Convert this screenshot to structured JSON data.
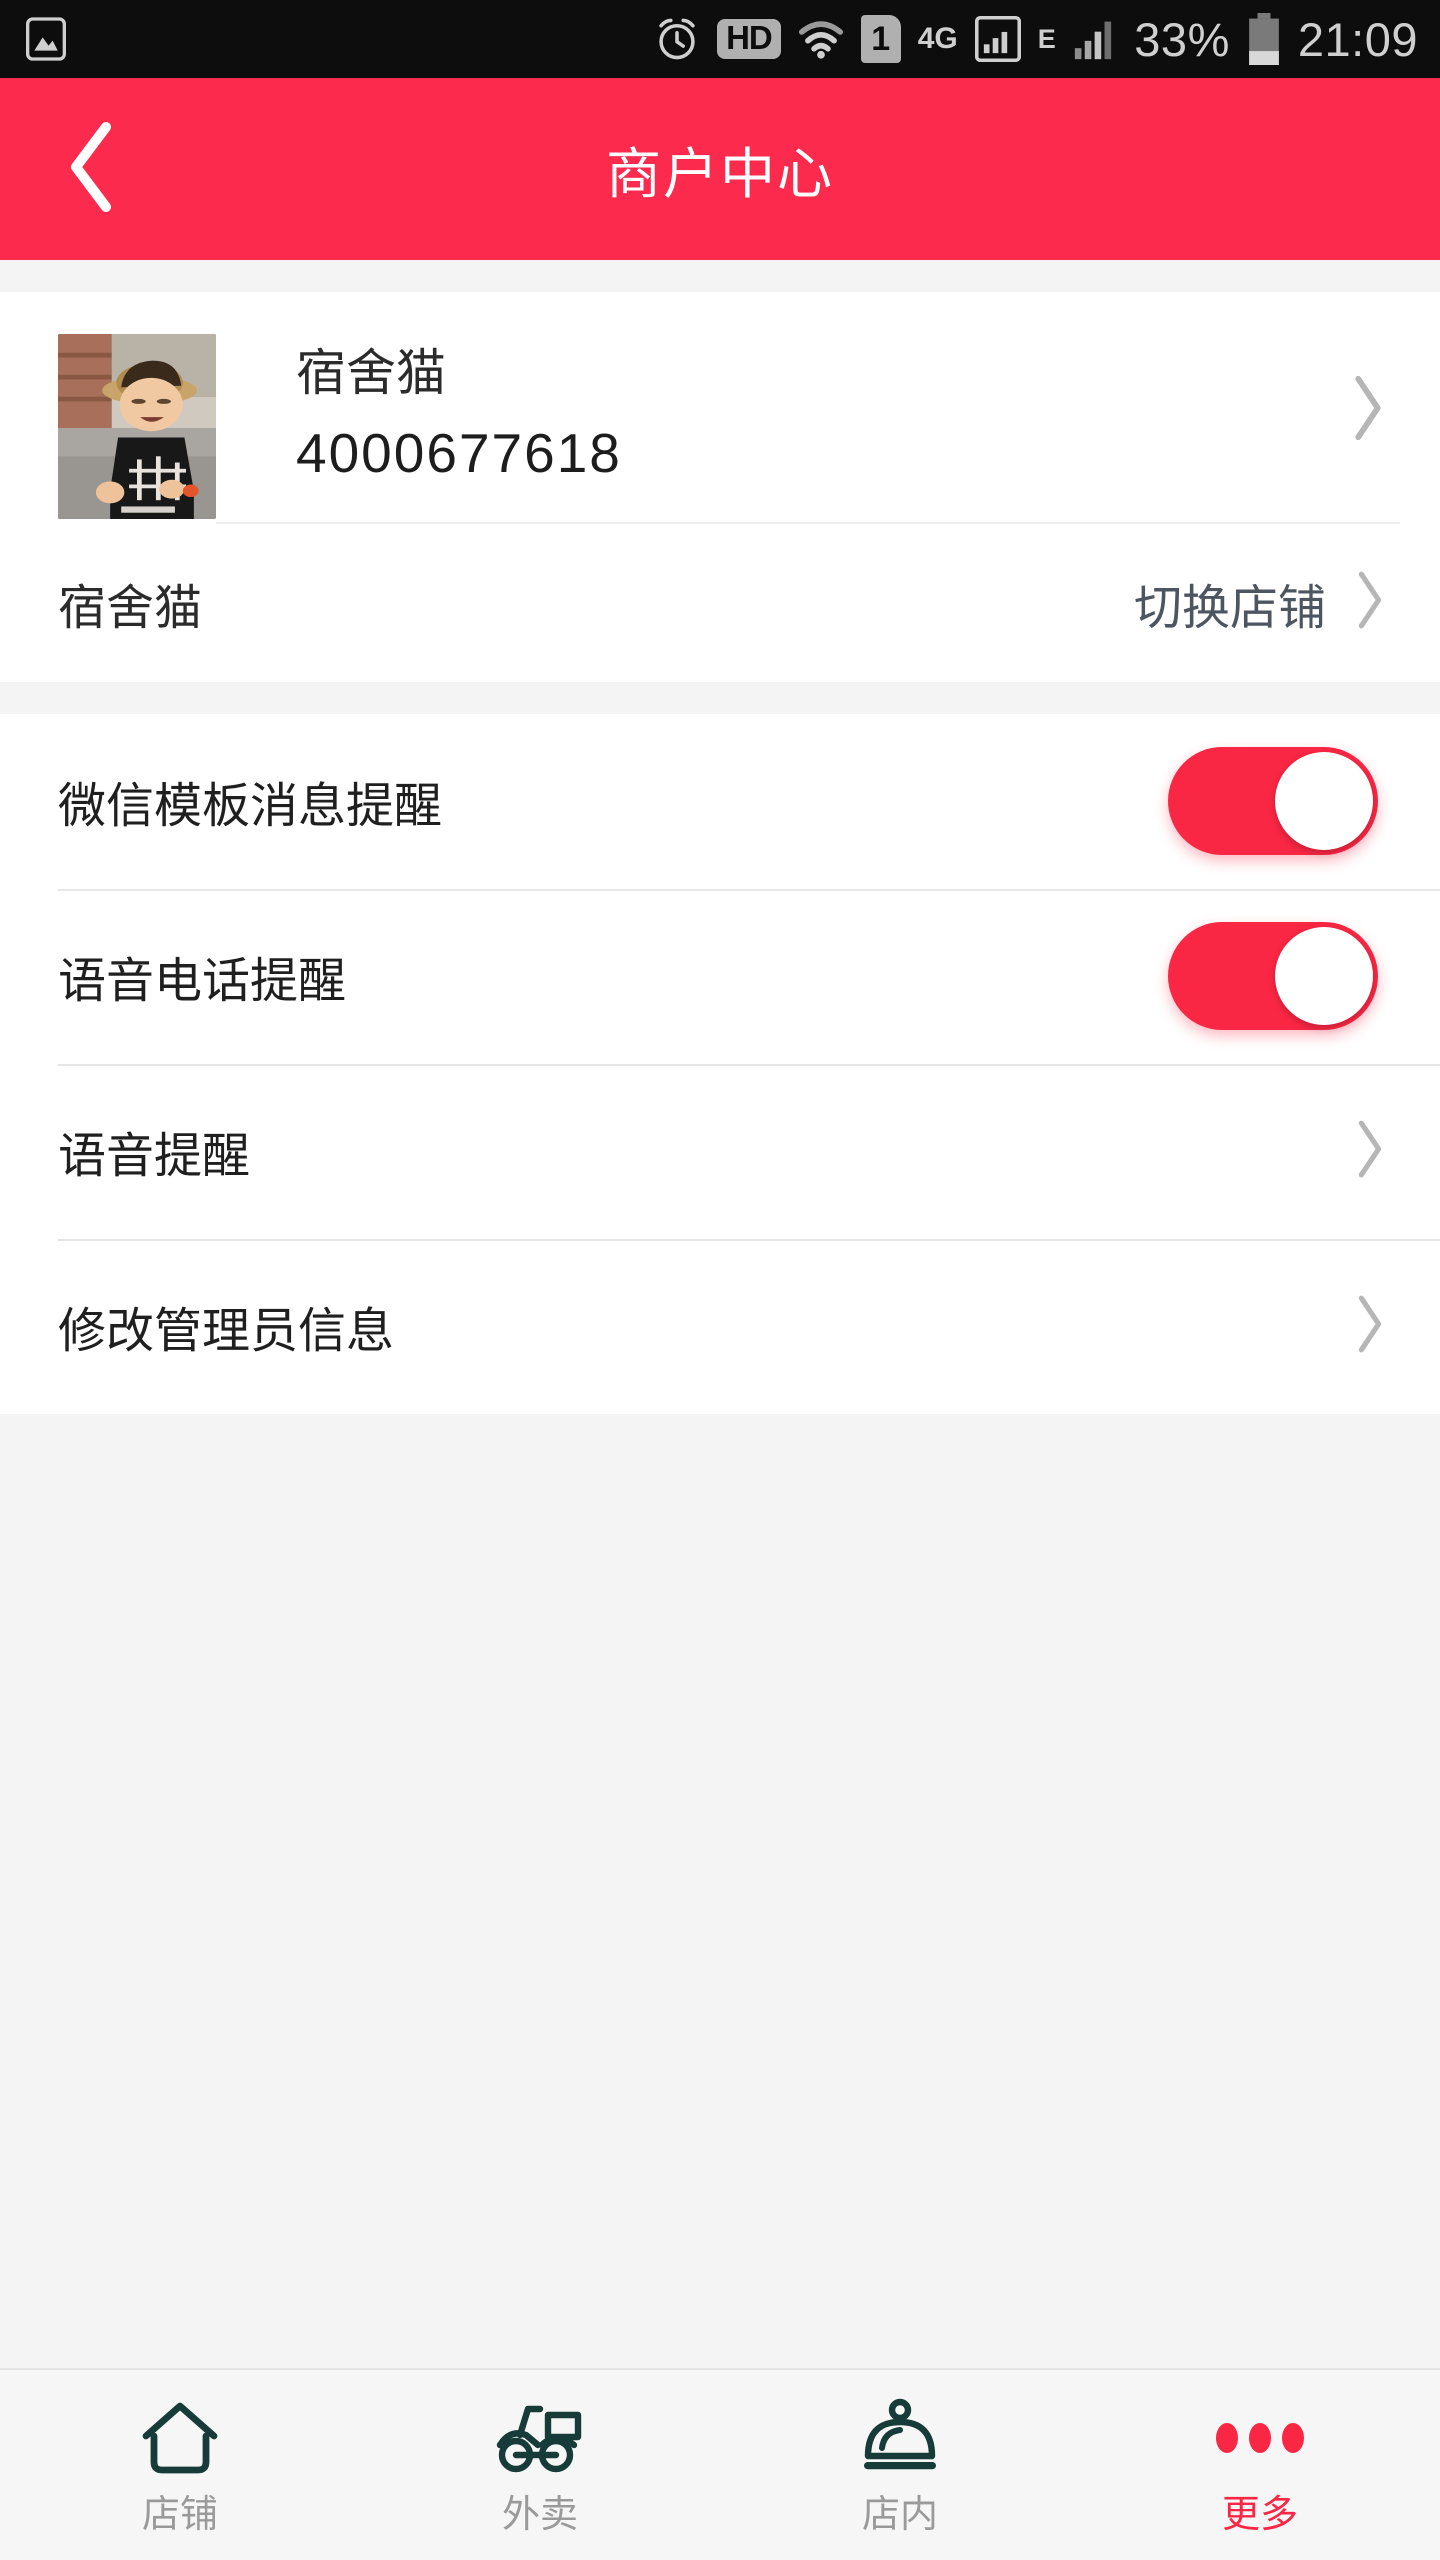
{
  "status_bar": {
    "gallery_icon": "image-icon",
    "alarm_icon": "alarm-clock-icon",
    "hd_badge": "HD",
    "wifi_icon": "wifi-icon",
    "sim_badge": "1",
    "network_type": "4G",
    "signal_icon_1": "signal-bars-icon",
    "edge_label": "E",
    "signal_icon_2": "signal-bars-icon",
    "battery_percent": "33%",
    "battery_icon": "battery-icon",
    "time": "21:09"
  },
  "header": {
    "title": "商户中心",
    "back_icon": "chevron-left-icon",
    "bg_color": "#fc2b4e"
  },
  "profile": {
    "avatar_icon": "user-avatar-photo",
    "name": "宿舍猫",
    "account_id": "4000677618",
    "chevron_icon": "chevron-right-icon"
  },
  "store": {
    "name": "宿舍猫",
    "action_label": "切换店铺",
    "chevron_icon": "chevron-right-icon"
  },
  "settings": {
    "rows": [
      {
        "label": "微信模板消息提醒",
        "type": "toggle",
        "value": "on",
        "accent": "#fa2744"
      },
      {
        "label": "语音电话提醒",
        "type": "toggle",
        "value": "on",
        "accent": "#fa2744"
      },
      {
        "label": "语音提醒",
        "type": "link",
        "chevron_icon": "chevron-right-icon"
      },
      {
        "label": "修改管理员信息",
        "type": "link",
        "chevron_icon": "chevron-right-icon"
      }
    ]
  },
  "tabbar": {
    "items": [
      {
        "label": "店铺",
        "icon": "home-icon",
        "active": false
      },
      {
        "label": "外卖",
        "icon": "scooter-delivery-icon",
        "active": false
      },
      {
        "label": "店内",
        "icon": "food-cloche-icon",
        "active": false
      },
      {
        "label": "更多",
        "icon": "more-dots-icon",
        "active": true
      }
    ],
    "active_color": "#fa2744",
    "inactive_color": "#9a9a9a",
    "icon_color": "#173b38"
  }
}
